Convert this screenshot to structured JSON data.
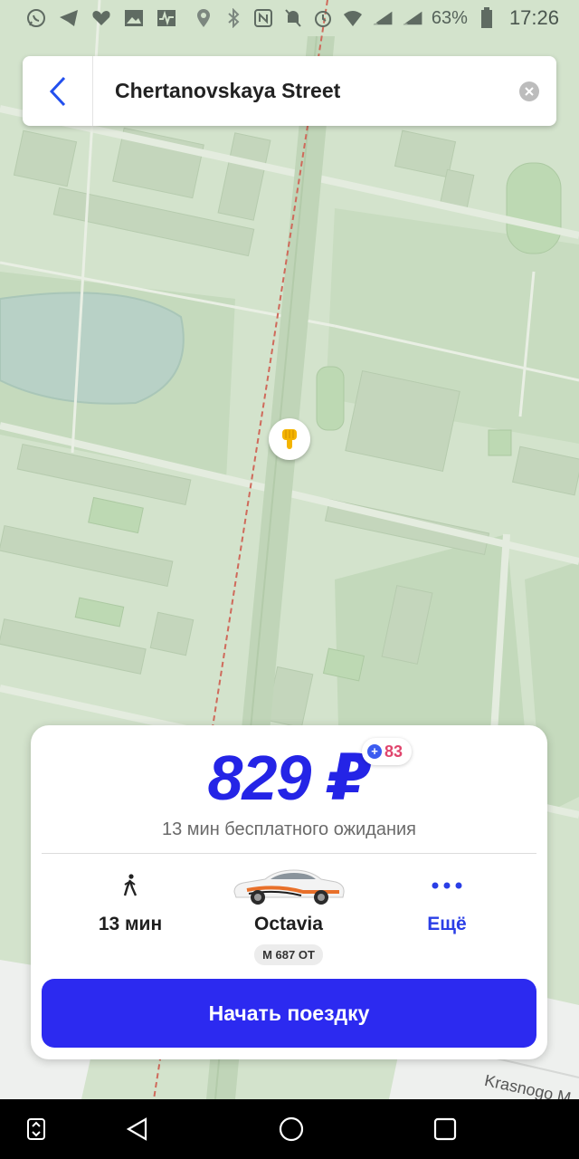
{
  "status_bar": {
    "battery_percent": "63%",
    "time": "17:26",
    "left_icons": [
      "whatsapp-icon",
      "telegram-icon",
      "health-icon",
      "gallery-icon",
      "pulse-icon"
    ],
    "right_icons": [
      "location-icon",
      "bluetooth-icon",
      "nfc-icon",
      "mute-icon",
      "alarm-icon",
      "wifi-icon",
      "signal-icon",
      "signal-icon",
      "battery-icon"
    ]
  },
  "search": {
    "text": "Chertanovskaya Street",
    "back_icon": "chevron-left-icon",
    "clear_icon": "clear-icon"
  },
  "marker": {
    "icon": "pointing-hand-icon"
  },
  "card": {
    "price": "829 ₽",
    "bonus_points": "83",
    "waiting_text": "13 мин бесплатного ожидания",
    "walk": {
      "icon": "walking-person-icon",
      "label": "13 мин"
    },
    "car": {
      "model": "Octavia",
      "plate": "М 687 ОТ",
      "icon": "car-icon"
    },
    "more": {
      "label": "Ещё",
      "icon": "more-dots-icon"
    },
    "start_button": "Начать поездку"
  },
  "map": {
    "street_label": "Krasnogo M"
  },
  "colors": {
    "accent": "#2c2af0",
    "price": "#2424e6",
    "bonus": "#e0456d",
    "map_bg": "#d3e3cc"
  },
  "nav_bar": {
    "icons": [
      "screen-switch-icon",
      "back-triangle-icon",
      "home-circle-icon",
      "recents-square-icon"
    ]
  }
}
